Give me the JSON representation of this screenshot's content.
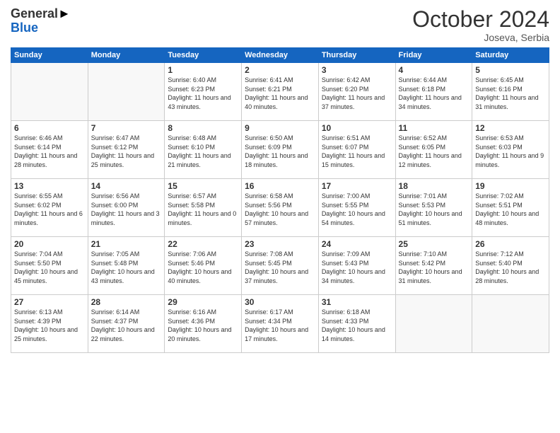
{
  "header": {
    "logo_general": "General",
    "logo_blue": "Blue",
    "month_title": "October 2024",
    "location": "Joseva, Serbia"
  },
  "weekdays": [
    "Sunday",
    "Monday",
    "Tuesday",
    "Wednesday",
    "Thursday",
    "Friday",
    "Saturday"
  ],
  "weeks": [
    [
      {
        "day": "",
        "info": ""
      },
      {
        "day": "",
        "info": ""
      },
      {
        "day": "1",
        "info": "Sunrise: 6:40 AM\nSunset: 6:23 PM\nDaylight: 11 hours and 43 minutes."
      },
      {
        "day": "2",
        "info": "Sunrise: 6:41 AM\nSunset: 6:21 PM\nDaylight: 11 hours and 40 minutes."
      },
      {
        "day": "3",
        "info": "Sunrise: 6:42 AM\nSunset: 6:20 PM\nDaylight: 11 hours and 37 minutes."
      },
      {
        "day": "4",
        "info": "Sunrise: 6:44 AM\nSunset: 6:18 PM\nDaylight: 11 hours and 34 minutes."
      },
      {
        "day": "5",
        "info": "Sunrise: 6:45 AM\nSunset: 6:16 PM\nDaylight: 11 hours and 31 minutes."
      }
    ],
    [
      {
        "day": "6",
        "info": "Sunrise: 6:46 AM\nSunset: 6:14 PM\nDaylight: 11 hours and 28 minutes."
      },
      {
        "day": "7",
        "info": "Sunrise: 6:47 AM\nSunset: 6:12 PM\nDaylight: 11 hours and 25 minutes."
      },
      {
        "day": "8",
        "info": "Sunrise: 6:48 AM\nSunset: 6:10 PM\nDaylight: 11 hours and 21 minutes."
      },
      {
        "day": "9",
        "info": "Sunrise: 6:50 AM\nSunset: 6:09 PM\nDaylight: 11 hours and 18 minutes."
      },
      {
        "day": "10",
        "info": "Sunrise: 6:51 AM\nSunset: 6:07 PM\nDaylight: 11 hours and 15 minutes."
      },
      {
        "day": "11",
        "info": "Sunrise: 6:52 AM\nSunset: 6:05 PM\nDaylight: 11 hours and 12 minutes."
      },
      {
        "day": "12",
        "info": "Sunrise: 6:53 AM\nSunset: 6:03 PM\nDaylight: 11 hours and 9 minutes."
      }
    ],
    [
      {
        "day": "13",
        "info": "Sunrise: 6:55 AM\nSunset: 6:02 PM\nDaylight: 11 hours and 6 minutes."
      },
      {
        "day": "14",
        "info": "Sunrise: 6:56 AM\nSunset: 6:00 PM\nDaylight: 11 hours and 3 minutes."
      },
      {
        "day": "15",
        "info": "Sunrise: 6:57 AM\nSunset: 5:58 PM\nDaylight: 11 hours and 0 minutes."
      },
      {
        "day": "16",
        "info": "Sunrise: 6:58 AM\nSunset: 5:56 PM\nDaylight: 10 hours and 57 minutes."
      },
      {
        "day": "17",
        "info": "Sunrise: 7:00 AM\nSunset: 5:55 PM\nDaylight: 10 hours and 54 minutes."
      },
      {
        "day": "18",
        "info": "Sunrise: 7:01 AM\nSunset: 5:53 PM\nDaylight: 10 hours and 51 minutes."
      },
      {
        "day": "19",
        "info": "Sunrise: 7:02 AM\nSunset: 5:51 PM\nDaylight: 10 hours and 48 minutes."
      }
    ],
    [
      {
        "day": "20",
        "info": "Sunrise: 7:04 AM\nSunset: 5:50 PM\nDaylight: 10 hours and 45 minutes."
      },
      {
        "day": "21",
        "info": "Sunrise: 7:05 AM\nSunset: 5:48 PM\nDaylight: 10 hours and 43 minutes."
      },
      {
        "day": "22",
        "info": "Sunrise: 7:06 AM\nSunset: 5:46 PM\nDaylight: 10 hours and 40 minutes."
      },
      {
        "day": "23",
        "info": "Sunrise: 7:08 AM\nSunset: 5:45 PM\nDaylight: 10 hours and 37 minutes."
      },
      {
        "day": "24",
        "info": "Sunrise: 7:09 AM\nSunset: 5:43 PM\nDaylight: 10 hours and 34 minutes."
      },
      {
        "day": "25",
        "info": "Sunrise: 7:10 AM\nSunset: 5:42 PM\nDaylight: 10 hours and 31 minutes."
      },
      {
        "day": "26",
        "info": "Sunrise: 7:12 AM\nSunset: 5:40 PM\nDaylight: 10 hours and 28 minutes."
      }
    ],
    [
      {
        "day": "27",
        "info": "Sunrise: 6:13 AM\nSunset: 4:39 PM\nDaylight: 10 hours and 25 minutes."
      },
      {
        "day": "28",
        "info": "Sunrise: 6:14 AM\nSunset: 4:37 PM\nDaylight: 10 hours and 22 minutes."
      },
      {
        "day": "29",
        "info": "Sunrise: 6:16 AM\nSunset: 4:36 PM\nDaylight: 10 hours and 20 minutes."
      },
      {
        "day": "30",
        "info": "Sunrise: 6:17 AM\nSunset: 4:34 PM\nDaylight: 10 hours and 17 minutes."
      },
      {
        "day": "31",
        "info": "Sunrise: 6:18 AM\nSunset: 4:33 PM\nDaylight: 10 hours and 14 minutes."
      },
      {
        "day": "",
        "info": ""
      },
      {
        "day": "",
        "info": ""
      }
    ]
  ]
}
